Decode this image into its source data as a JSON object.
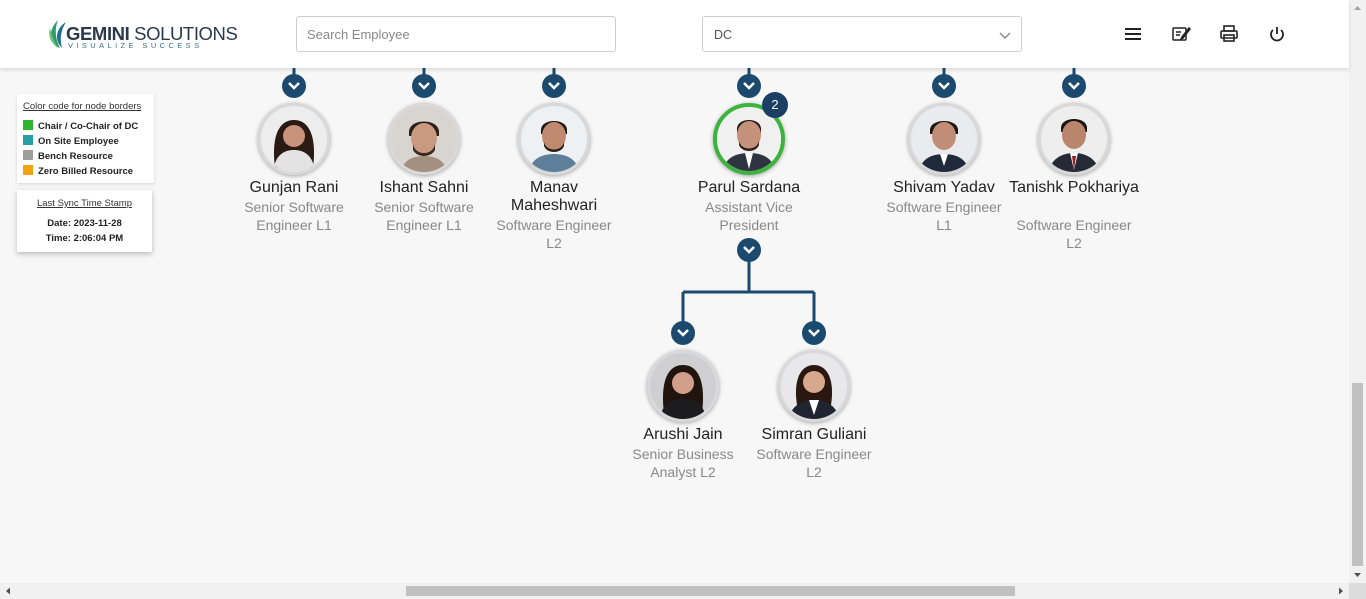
{
  "header": {
    "logo": {
      "word1": "GEMINI",
      "word2": "SOLUTIONS",
      "tagline": "VISUALIZE SUCCESS"
    },
    "search": {
      "placeholder": "Search Employee",
      "value": ""
    },
    "dc_select": {
      "selected": "DC"
    },
    "icons": [
      "menu-icon",
      "edit-note-icon",
      "print-icon",
      "power-icon"
    ]
  },
  "legend": {
    "title": "Color code for node borders",
    "items": [
      {
        "label": "Chair / Co-Chair of DC",
        "color": "#2db52d"
      },
      {
        "label": "On Site Employee",
        "color": "#26a0a6"
      },
      {
        "label": "Bench Resource",
        "color": "#9e9e9e"
      },
      {
        "label": "Zero Billed Resource",
        "color": "#f2a30f"
      }
    ]
  },
  "sync": {
    "title": "Last Sync Time Stamp",
    "date": "Date: 2023-11-28",
    "time": "Time: 2:06:04 PM"
  },
  "colors": {
    "connector": "#1c4a6e",
    "chair_border": "#3cb33c",
    "badge": "#1c3f66"
  },
  "nodes": [
    {
      "name": "Gunjan Rani",
      "role": "Senior Software Engineer L1"
    },
    {
      "name": "Ishant Sahni",
      "role": "Senior Software Engineer L1"
    },
    {
      "name": "Manav Maheshwari",
      "role": "Software Engineer L2"
    },
    {
      "name": "Parul Sardana",
      "role": "Assistant Vice President",
      "badge": "2"
    },
    {
      "name": "Shivam Yadav",
      "role": "Software Engineer L1"
    },
    {
      "name": "Tanishk Pokhariya",
      "role": "Software Engineer L2"
    },
    {
      "name": "Arushi Jain",
      "role": "Senior Business Analyst L2"
    },
    {
      "name": "Simran Guliani",
      "role": "Software Engineer L2"
    }
  ]
}
